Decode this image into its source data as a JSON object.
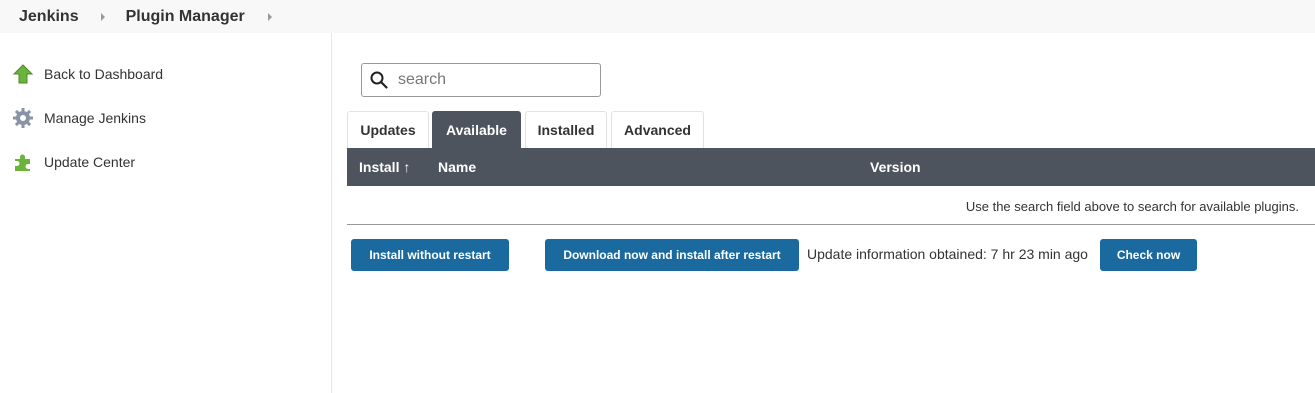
{
  "breadcrumb": {
    "items": [
      "Jenkins",
      "Plugin Manager"
    ]
  },
  "sidebar": {
    "items": [
      {
        "label": "Back to Dashboard",
        "icon": "up-arrow-icon"
      },
      {
        "label": "Manage Jenkins",
        "icon": "gear-icon"
      },
      {
        "label": "Update Center",
        "icon": "puzzle-icon"
      }
    ]
  },
  "search": {
    "placeholder": "search",
    "value": ""
  },
  "tabs": [
    {
      "label": "Updates",
      "active": false
    },
    {
      "label": "Available",
      "active": true
    },
    {
      "label": "Installed",
      "active": false
    },
    {
      "label": "Advanced",
      "active": false
    }
  ],
  "table": {
    "columns": [
      "Install ↑",
      "Name",
      "Version"
    ],
    "empty_message": "Use the search field above to search for available plugins."
  },
  "actions": {
    "install_without_restart": "Install without restart",
    "download_and_install": "Download now and install after restart",
    "update_info": "Update information obtained: 7 hr 23 min ago",
    "check_now": "Check now"
  },
  "colors": {
    "header_dark": "#4d545d",
    "button_blue": "#1a6aa0",
    "icon_green": "#6cb33e"
  }
}
